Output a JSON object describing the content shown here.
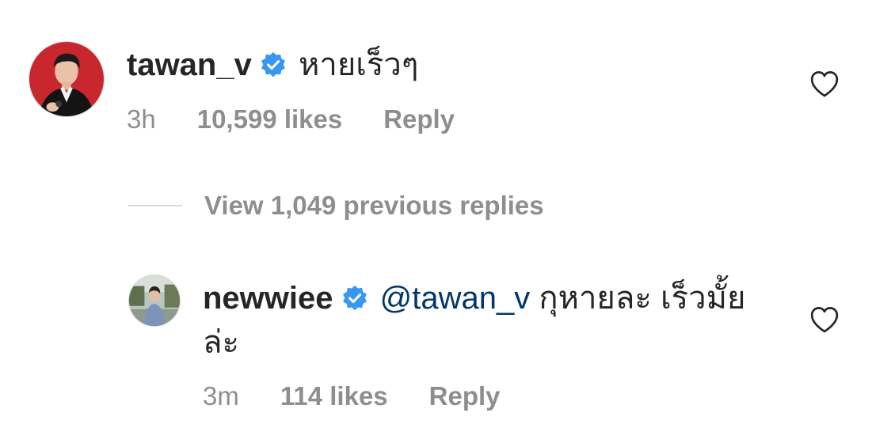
{
  "comment": {
    "username": "tawan_v",
    "verified_icon": "verified-badge-icon",
    "text": "หายเร็วๆ",
    "time": "3h",
    "likes": "10,599 likes",
    "reply_label": "Reply",
    "like_icon": "heart-outline-icon"
  },
  "view_replies": {
    "label": "View 1,049 previous replies"
  },
  "reply": {
    "username": "newwiee",
    "verified_icon": "verified-badge-icon",
    "mention": "@tawan_v",
    "text_line1": "กุหายละ เร็วมั้ย",
    "text_line2": "ล่ะ",
    "time": "3m",
    "likes": "114 likes",
    "reply_label": "Reply",
    "like_icon": "heart-outline-icon"
  },
  "colors": {
    "text": "#262626",
    "secondary": "#8e8e8e",
    "mention": "#00376b",
    "verified": "#3897f0",
    "avatar1_bg": "#c8272d"
  }
}
